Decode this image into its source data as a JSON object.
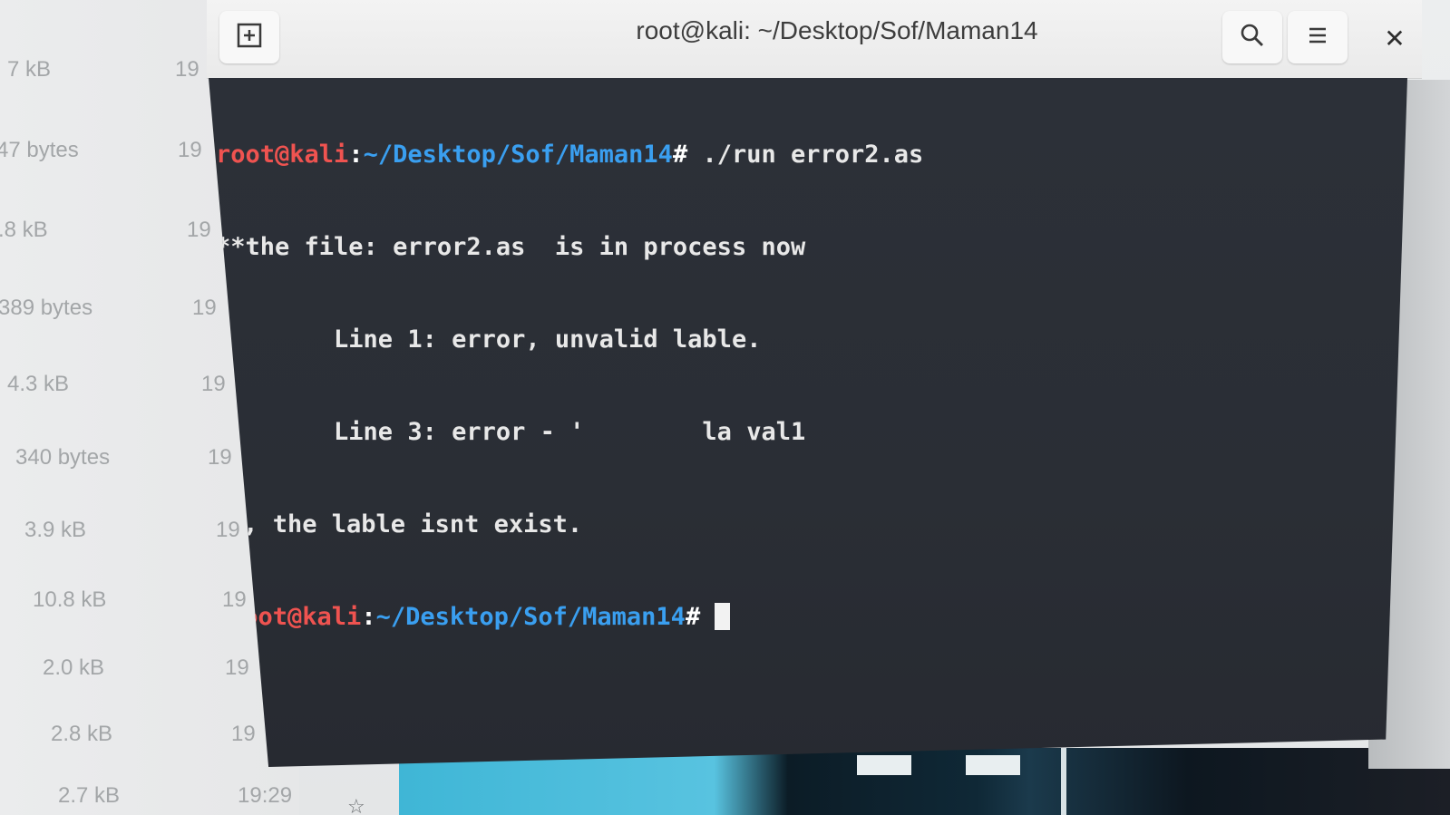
{
  "file_manager": {
    "rows": [
      {
        "size": "7 kB",
        "time": "19"
      },
      {
        "size": "47 bytes",
        "time": "19"
      },
      {
        "size": ".8 kB",
        "time": "19"
      },
      {
        "size": "389 bytes",
        "time": "19"
      },
      {
        "size": "4.3 kB",
        "time": "19"
      },
      {
        "size": "340 bytes",
        "time": "19"
      },
      {
        "size": "3.9 kB",
        "time": "19"
      },
      {
        "size": "10.8 kB",
        "time": "19"
      },
      {
        "size": "2.0 kB",
        "time": "19"
      },
      {
        "size": "2.8 kB",
        "time": "19"
      },
      {
        "size": "2.7 kB",
        "time": "19:29"
      }
    ],
    "star_icon": "star-icon"
  },
  "terminal": {
    "title": "root@kali: ~/Desktop/Sof/Maman14",
    "new_tab_icon": "new-tab-icon",
    "search_icon": "search-icon",
    "menu_icon": "hamburger-menu-icon",
    "close_icon": "close-icon",
    "prompt": {
      "user": "root@kali",
      "colon": ":",
      "path": "~/Desktop/Sof/Maman14",
      "hash": "# "
    },
    "command": "./run error2.as",
    "output": [
      "**the file: error2.as  is in process now",
      "        Line 1: error, unvalid lable.",
      "        Line 3: error - '        la val1",
      "', the lable isnt exist."
    ],
    "colors": {
      "background": "#2c3038",
      "prompt_user": "#ef5350",
      "prompt_path": "#3a9ff0",
      "text": "#e8e8e8"
    }
  }
}
